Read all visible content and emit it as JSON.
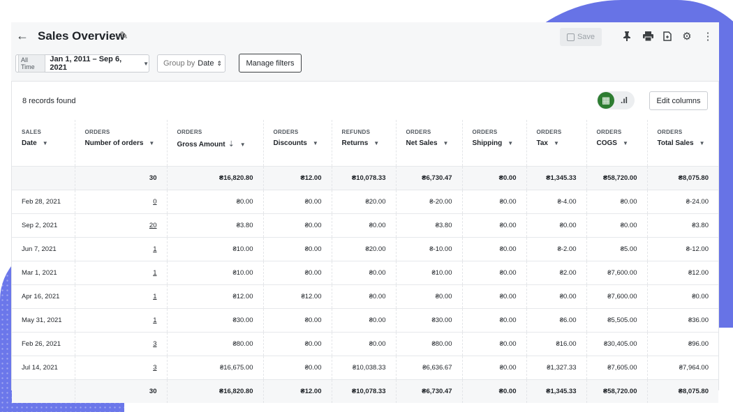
{
  "header": {
    "title": "Sales Overview",
    "save_label": "Save",
    "icons": [
      "back-arrow-icon",
      "pencil-icon",
      "pin-icon",
      "print-icon",
      "export-icon",
      "gear-icon",
      "more-vertical-icon"
    ]
  },
  "filters": {
    "range_badge": "All Time",
    "range_value": "Jan 1, 2011 – Sep 6, 2021",
    "groupby_prefix": "Group by",
    "groupby_value": "Date",
    "manage_label": "Manage filters"
  },
  "summary": {
    "records": "8 records found",
    "edit_columns_label": "Edit columns"
  },
  "columns": [
    {
      "group": "SALES",
      "label": "Date"
    },
    {
      "group": "ORDERS",
      "label": "Number of orders"
    },
    {
      "group": "ORDERS",
      "label": "Gross Amount"
    },
    {
      "group": "ORDERS",
      "label": "Discounts"
    },
    {
      "group": "REFUNDS",
      "label": "Returns"
    },
    {
      "group": "ORDERS",
      "label": "Net Sales"
    },
    {
      "group": "ORDERS",
      "label": "Shipping"
    },
    {
      "group": "ORDERS",
      "label": "Tax"
    },
    {
      "group": "ORDERS",
      "label": "COGS"
    },
    {
      "group": "ORDERS",
      "label": "Total Sales"
    }
  ],
  "total_row": [
    "",
    "30",
    "₴16,820.80",
    "₴12.00",
    "₴10,078.33",
    "₴6,730.47",
    "₴0.00",
    "₴1,345.33",
    "₴58,720.00",
    "₴8,075.80"
  ],
  "rows": [
    [
      "Feb 28, 2021",
      "0",
      "₴0.00",
      "₴0.00",
      "₴20.00",
      "₴-20.00",
      "₴0.00",
      "₴-4.00",
      "₴0.00",
      "₴-24.00"
    ],
    [
      "Sep 2, 2021",
      "20",
      "₴3.80",
      "₴0.00",
      "₴0.00",
      "₴3.80",
      "₴0.00",
      "₴0.00",
      "₴0.00",
      "₴3.80"
    ],
    [
      "Jun 7, 2021",
      "1",
      "₴10.00",
      "₴0.00",
      "₴20.00",
      "₴-10.00",
      "₴0.00",
      "₴-2.00",
      "₴5.00",
      "₴-12.00"
    ],
    [
      "Mar 1, 2021",
      "1",
      "₴10.00",
      "₴0.00",
      "₴0.00",
      "₴10.00",
      "₴0.00",
      "₴2.00",
      "₴7,600.00",
      "₴12.00"
    ],
    [
      "Apr 16, 2021",
      "1",
      "₴12.00",
      "₴12.00",
      "₴0.00",
      "₴0.00",
      "₴0.00",
      "₴0.00",
      "₴7,600.00",
      "₴0.00"
    ],
    [
      "May 31, 2021",
      "1",
      "₴30.00",
      "₴0.00",
      "₴0.00",
      "₴30.00",
      "₴0.00",
      "₴6.00",
      "₴5,505.00",
      "₴36.00"
    ],
    [
      "Feb 26, 2021",
      "3",
      "₴80.00",
      "₴0.00",
      "₴0.00",
      "₴80.00",
      "₴0.00",
      "₴16.00",
      "₴30,405.00",
      "₴96.00"
    ],
    [
      "Jul 14, 2021",
      "3",
      "₴16,675.00",
      "₴0.00",
      "₴10,038.33",
      "₴6,636.67",
      "₴0.00",
      "₴1,327.33",
      "₴7,605.00",
      "₴7,964.00"
    ]
  ],
  "footer_row": [
    "",
    "30",
    "₴16,820.80",
    "₴12.00",
    "₴10,078.33",
    "₴6,730.47",
    "₴0.00",
    "₴1,345.33",
    "₴58,720.00",
    "₴8,075.80"
  ],
  "colors": {
    "accent": "#2e7d32",
    "background_shape": "#6773e6"
  }
}
